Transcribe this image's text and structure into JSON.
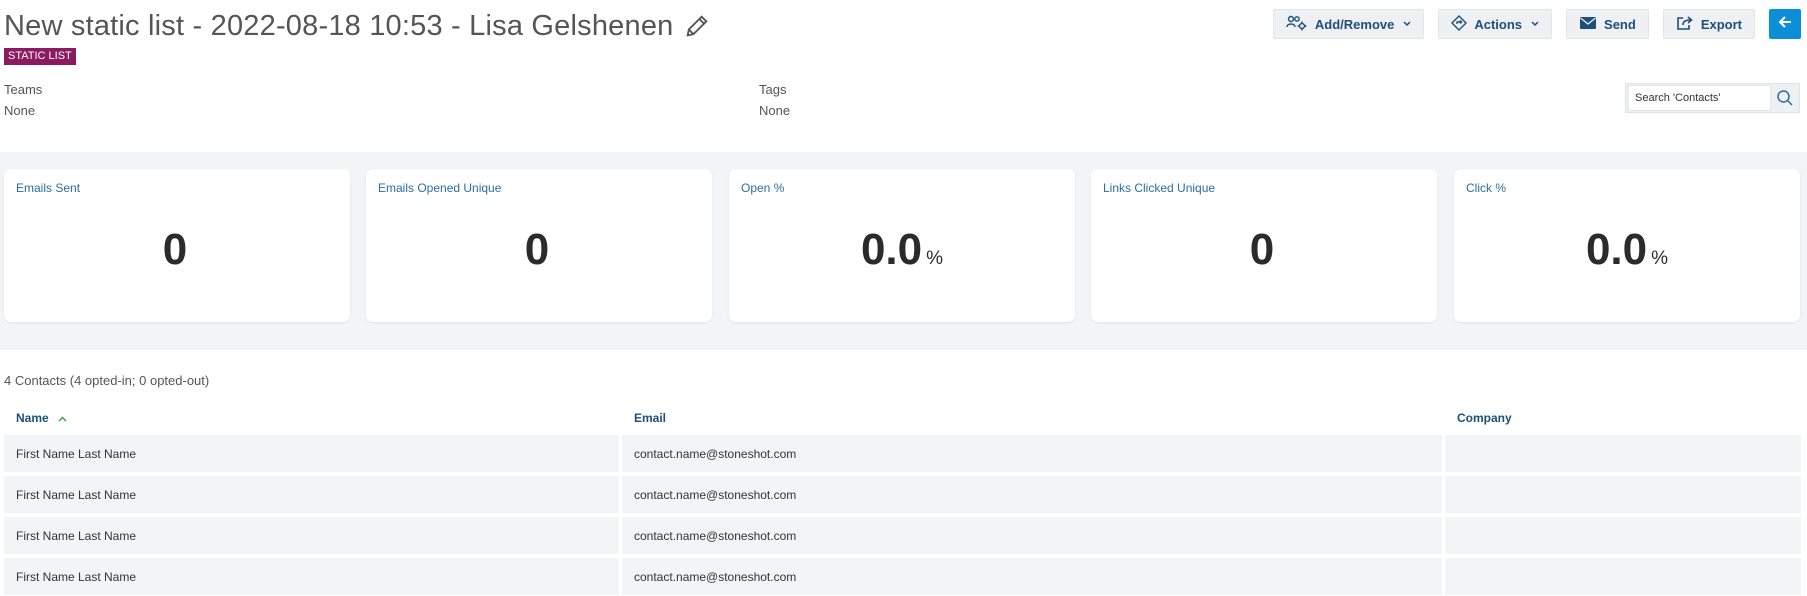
{
  "header": {
    "title": "New static list - 2022-08-18 10:53 - Lisa Gelshenen",
    "badge": "STATIC LIST"
  },
  "toolbar": {
    "add_remove_label": "Add/Remove",
    "actions_label": "Actions",
    "send_label": "Send",
    "export_label": "Export"
  },
  "meta": {
    "teams": {
      "label": "Teams",
      "value": "None"
    },
    "tags": {
      "label": "Tags",
      "value": "None"
    }
  },
  "search": {
    "placeholder": "Search 'Contacts'"
  },
  "stats": [
    {
      "label": "Emails Sent",
      "value": "0",
      "unit": ""
    },
    {
      "label": "Emails Opened Unique",
      "value": "0",
      "unit": ""
    },
    {
      "label": "Open %",
      "value": "0.0",
      "unit": "%"
    },
    {
      "label": "Links Clicked Unique",
      "value": "0",
      "unit": ""
    },
    {
      "label": "Click %",
      "value": "0.0",
      "unit": "%"
    }
  ],
  "contacts": {
    "summary": "4 Contacts (4 opted-in; 0 opted-out)",
    "columns": [
      "Name",
      "Email",
      "Company"
    ],
    "rows": [
      {
        "name": "First Name Last Name",
        "email": "contact.name@stoneshot.com",
        "company": ""
      },
      {
        "name": "First Name Last Name",
        "email": "contact.name@stoneshot.com",
        "company": ""
      },
      {
        "name": "First Name Last Name",
        "email": "contact.name@stoneshot.com",
        "company": ""
      },
      {
        "name": "First Name Last Name",
        "email": "contact.name@stoneshot.com",
        "company": ""
      }
    ]
  },
  "colors": {
    "badge": "#8b1a5e",
    "link_blue": "#1d4f7a",
    "stat_label": "#2c6da3",
    "back_button": "#0d8ed9",
    "band": "#f3f4f6"
  },
  "icons": {
    "edit": "pencil-icon",
    "add_remove": "users-gear-icon",
    "actions": "diamond-arrow-icon",
    "send": "envelope-icon",
    "export": "share-export-icon",
    "back": "arrow-left-icon",
    "search": "search-icon",
    "sort": "sort-ascending-icon"
  }
}
